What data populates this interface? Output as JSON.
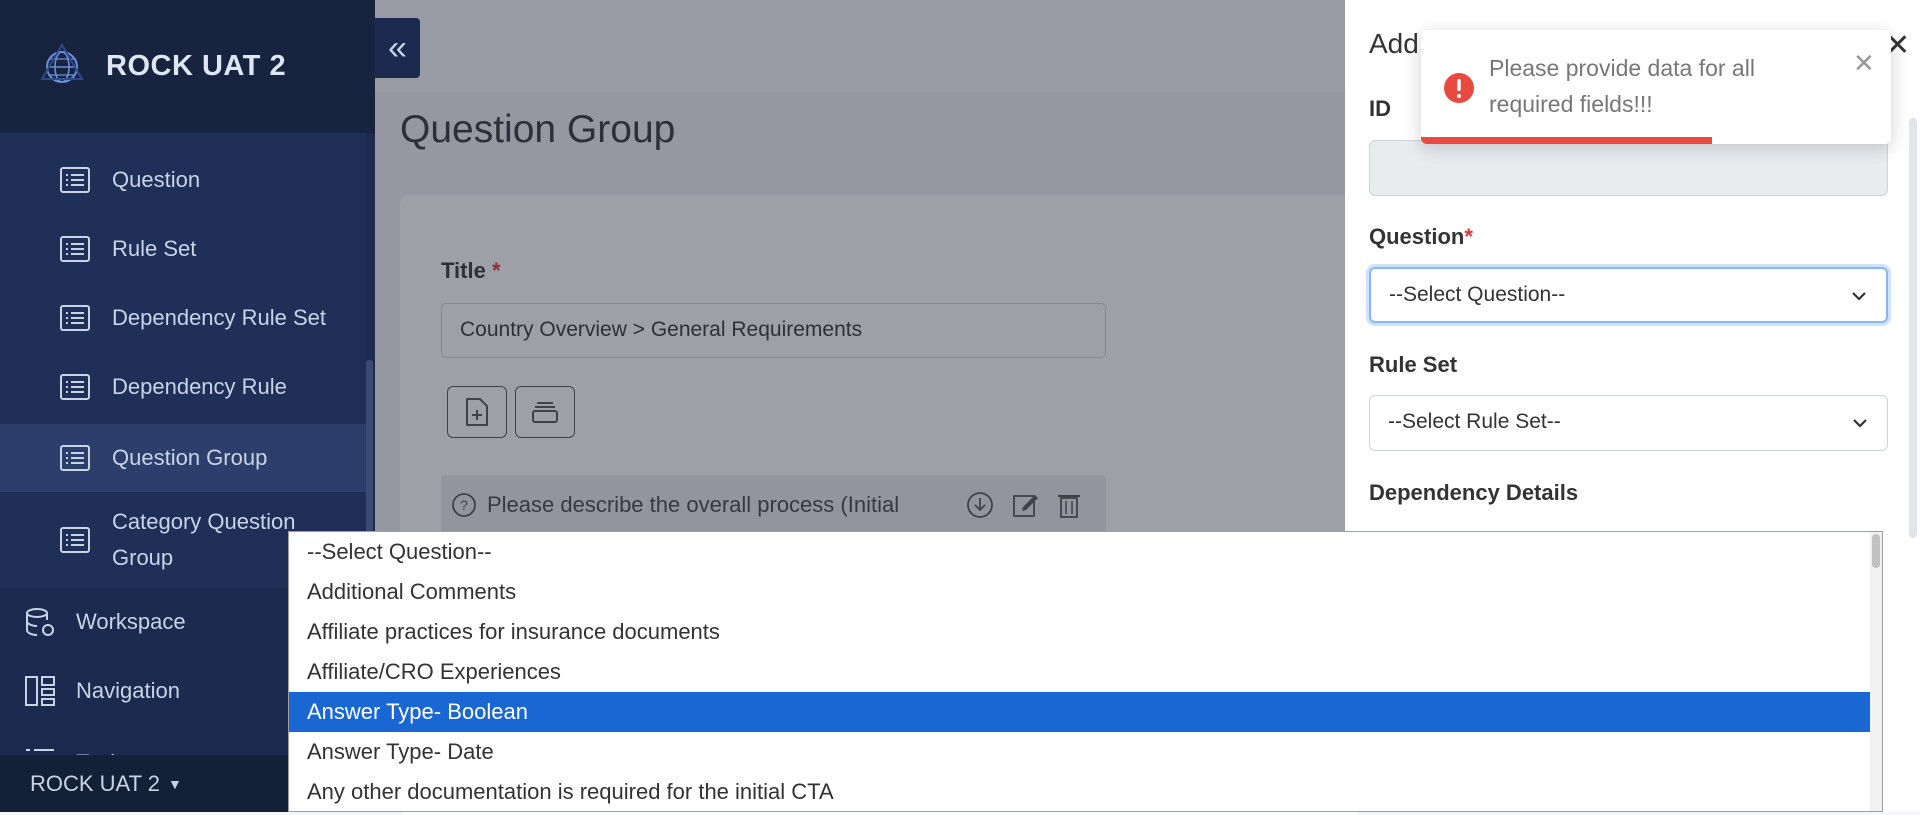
{
  "app": {
    "title": "ROCK UAT 2",
    "footer_label": "ROCK UAT 2"
  },
  "sidebar": {
    "items": [
      {
        "label": "Question"
      },
      {
        "label": "Rule Set"
      },
      {
        "label": "Dependency Rule Set"
      },
      {
        "label": "Dependency Rule"
      },
      {
        "label": "Question Group",
        "active": true
      },
      {
        "label": "Category Question Group"
      }
    ],
    "top_items": [
      {
        "label": "Workspace",
        "icon": "database-gear-icon"
      },
      {
        "label": "Navigation",
        "icon": "layout-icon"
      },
      {
        "label": "Tasks",
        "icon": "list-icon"
      }
    ]
  },
  "main": {
    "page_title": "Question Group",
    "title_label": "Title",
    "required_mark": "*",
    "title_value": "Country Overview > General Requirements",
    "question_row_text": "Please describe the overall process (Initial"
  },
  "panel": {
    "title": "Add",
    "id_label": "ID",
    "id_value": "",
    "question_label": "Question",
    "question_required": "*",
    "question_value": "--Select Question--",
    "ruleset_label": "Rule Set",
    "ruleset_value": "--Select Rule Set--",
    "dependency_label": "Dependency Details"
  },
  "toast": {
    "message": "Please provide data for all required fields!!!",
    "progress": 0.62,
    "color": "#e94a3f"
  },
  "dropdown": {
    "options": [
      "--Select Question--",
      "Additional Comments",
      "Affiliate practices for insurance documents",
      "Affiliate/CRO Experiences",
      "Answer Type- Boolean",
      "Answer Type- Date",
      "Any other documentation is required for the initial CTA"
    ],
    "selected_index": 4,
    "highlight_color": "#1967d2"
  }
}
